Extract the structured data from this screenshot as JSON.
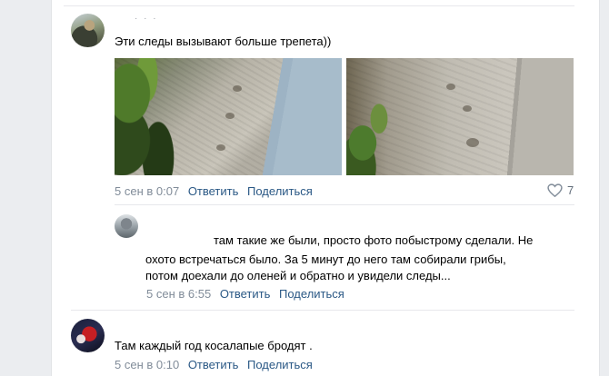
{
  "comments": [
    {
      "text": "Эти следы вызывают больше трепета))",
      "time": "5 сен в 0:07",
      "reply_label": "Ответить",
      "share_label": "Поделиться",
      "likes": "7"
    },
    {
      "text_lines": [
        "там такие же были, просто фото побыстрому сделали. Не",
        "охото встречаться было. За 5 минут до него там собирали грибы,",
        "потом доехали до оленей и обратно и увидели следы..."
      ],
      "time": "5 сен в 6:55",
      "reply_label": "Ответить",
      "share_label": "Поделиться"
    },
    {
      "text": "Там каждый год косалапые бродят .",
      "time": "5 сен в 0:10",
      "reply_label": "Ответить",
      "share_label": "Поделиться"
    }
  ],
  "colors": {
    "link": "#2a5885",
    "meta": "#818c99",
    "background": "#ebedf0"
  },
  "icons": {
    "like": "heart-outline-icon"
  }
}
